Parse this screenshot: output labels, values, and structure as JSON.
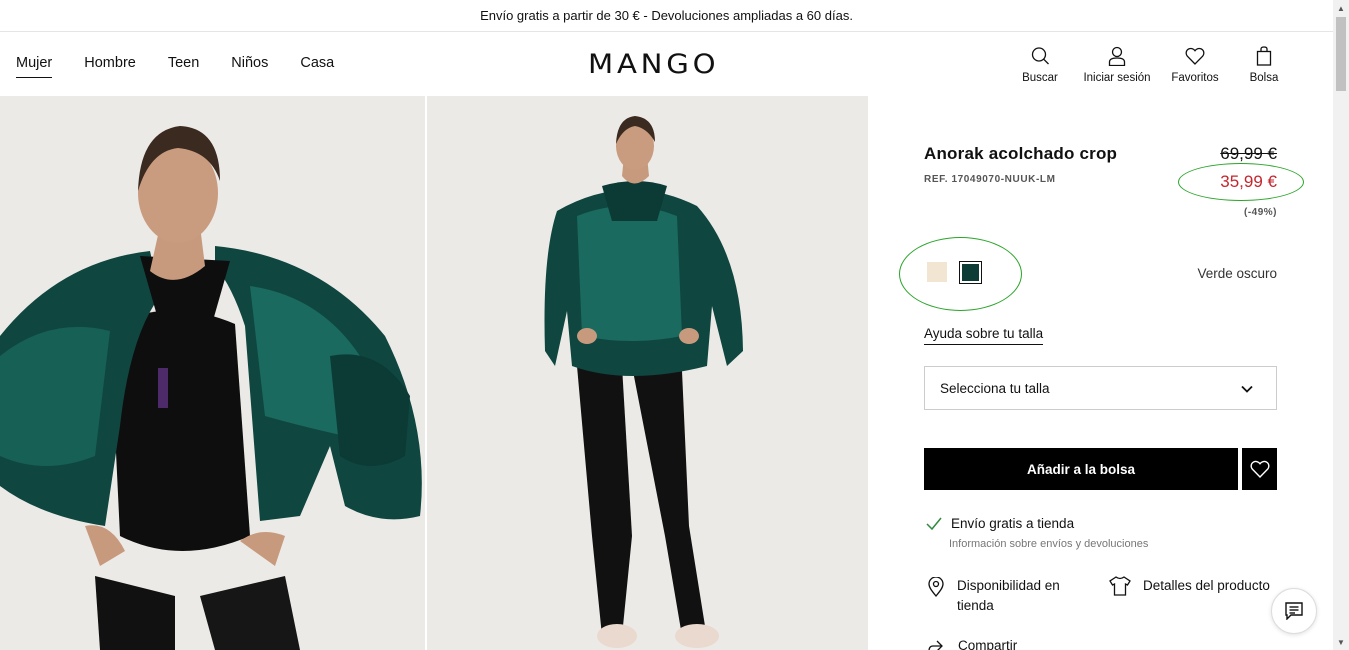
{
  "promo_bar": {
    "text": "Envío gratis a partir de 30 € - Devoluciones ampliadas a 60 días."
  },
  "header": {
    "nav": [
      {
        "label": "Mujer",
        "active": true
      },
      {
        "label": "Hombre"
      },
      {
        "label": "Teen"
      },
      {
        "label": "Niños"
      },
      {
        "label": "Casa"
      }
    ],
    "logo": "MANGO",
    "actions": {
      "search": {
        "label": "Buscar",
        "icon": "search-icon"
      },
      "login": {
        "label": "Iniciar sesión",
        "icon": "user-icon"
      },
      "favorites": {
        "label": "Favoritos",
        "icon": "heart-icon"
      },
      "bag": {
        "label": "Bolsa",
        "icon": "shopping-bag-icon"
      }
    }
  },
  "product": {
    "title": "Anorak acolchado crop",
    "ref": "REF. 17049070-NUUK-LM",
    "old_price": "69,99 €",
    "new_price": "35,99 €",
    "discount": "(-49%)",
    "colors": [
      {
        "name": "cream",
        "hex": "#f2e6d3"
      },
      {
        "name": "Verde oscuro",
        "hex": "#0d3b36",
        "selected": true
      }
    ],
    "selected_color": "Verde oscuro",
    "size_help": "Ayuda sobre tu talla",
    "size_select": {
      "value": "Selecciona tu talla"
    },
    "add_to_bag": "Añadir a la bolsa",
    "shipping": {
      "label": "Envío gratis a tienda",
      "info": "Información sobre envíos y devoluciones"
    },
    "store_availability": "Disponibilidad en tienda",
    "product_details": "Detalles del producto",
    "share": "Compartir"
  },
  "colors": {
    "sale_price": "#c4262e",
    "annotation_circle": "#2aa52a",
    "button_bg": "#000000",
    "photo_bg": "#eceae6"
  }
}
